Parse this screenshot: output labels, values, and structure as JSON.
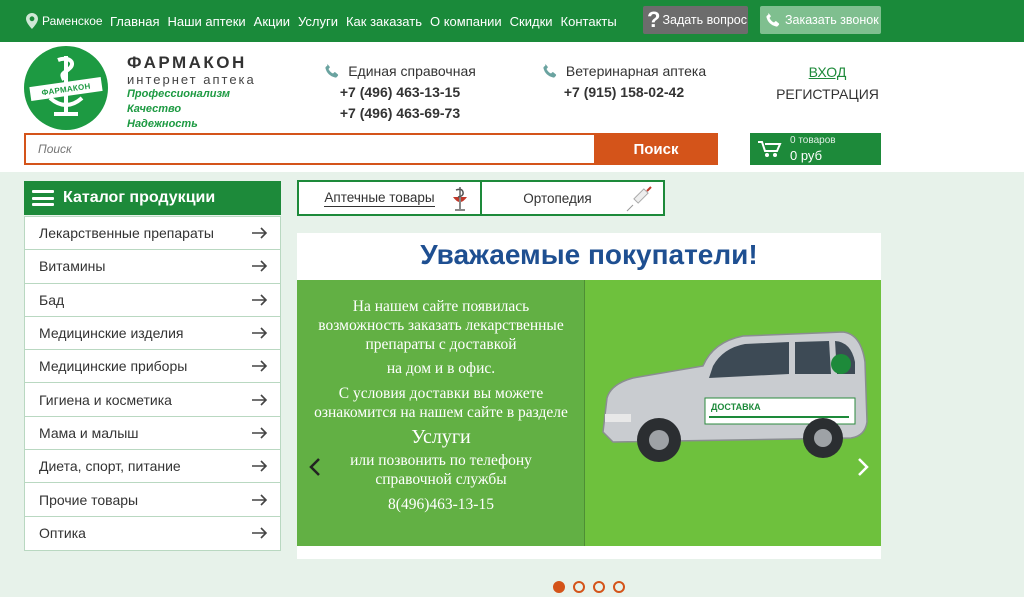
{
  "topbar": {
    "city": "Раменское",
    "nav": [
      "Главная",
      "Наши аптеки",
      "Акции",
      "Услуги",
      "Как заказать",
      "О компании",
      "Скидки",
      "Контакты"
    ],
    "ask_button": "Задать вопрос",
    "call_button": "Заказать звонок"
  },
  "brand": {
    "logo_text": "ФАРМАКОН",
    "name": "ФАРМАКОН",
    "subtitle": "интернет аптека",
    "slogans": [
      "Профессионализм",
      "Качество",
      "Надежность"
    ]
  },
  "contacts": {
    "main": {
      "title": "Единая справочная",
      "phones": [
        "+7 (496) 463-13-15",
        "+7 (496) 463-69-73"
      ]
    },
    "vet": {
      "title": "Ветеринарная аптека",
      "phones": [
        "+7 (915) 158-02-42"
      ]
    }
  },
  "auth": {
    "login": "ВХОД",
    "register": "РЕГИСТРАЦИЯ"
  },
  "search": {
    "placeholder": "Поиск",
    "button": "Поиск"
  },
  "cart": {
    "count": "0 товаров",
    "sum": "0 руб"
  },
  "catalog": {
    "title": "Каталог продукции",
    "items": [
      "Лекарственные препараты",
      "Витамины",
      "Бад",
      "Медицинские изделия",
      "Медицинские приборы",
      "Гигиена и косметика",
      "Мама и малыш",
      "Диета, спорт, питание",
      "Прочие товары",
      "Оптика"
    ]
  },
  "tabs": [
    {
      "label": "Аптечные товары",
      "active": true,
      "icon": "bowl-of-hygieia-icon"
    },
    {
      "label": "Ортопедия",
      "active": false,
      "icon": "syringe-icon"
    }
  ],
  "banner": {
    "title": "Уважаемые покупатели!",
    "lines": [
      "На нашем сайте появилась",
      "возможность заказать лекарственные",
      "препараты с доставкой",
      "на дом и в офис.",
      "С условия доставки вы можете",
      "ознакомится на нашем сайте в разделе",
      "Услуги",
      "или позвонить по телефону",
      "справочной службы",
      "8(496)463-13-15"
    ],
    "car_label": "ДОСТАВКА"
  },
  "slider": {
    "total": 4,
    "active": 1
  },
  "colors": {
    "primary": "#1a8a3a",
    "accent": "#d4541a",
    "banner_green": "#6ec13d",
    "title_blue": "#1e4f91"
  }
}
